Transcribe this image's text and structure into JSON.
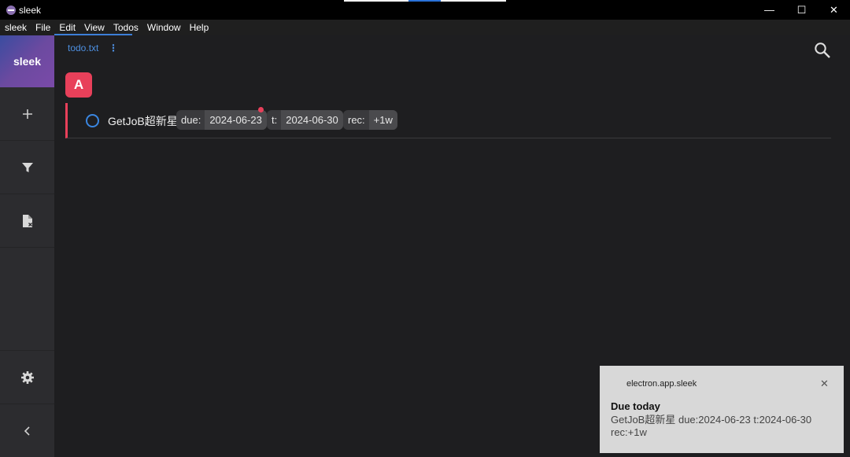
{
  "window": {
    "title": "sleek",
    "minimize": "—",
    "maximize": "☐",
    "close": "✕"
  },
  "menu": [
    "sleek",
    "File",
    "Edit",
    "View",
    "Todos",
    "Window",
    "Help"
  ],
  "sidebar": {
    "brand": "sleek",
    "items": [
      {
        "icon": "plus-icon"
      },
      {
        "icon": "filter-icon"
      },
      {
        "icon": "file-close-icon"
      }
    ],
    "bottom": [
      {
        "icon": "gear-icon"
      },
      {
        "icon": "chevron-left-icon"
      }
    ]
  },
  "main": {
    "file_tab": "todo.txt",
    "file_tab_menu": "⋮",
    "priority_group": "A",
    "todo": {
      "text": "GetJoB超新星",
      "due_key": "due:",
      "due_value": "2024-06-23",
      "t_key": "t:",
      "t_value": "2024-06-30",
      "rec_key": "rec:",
      "rec_value": "+1w"
    }
  },
  "notification": {
    "app": "electron.app.sleek",
    "close": "✕",
    "title": "Due today",
    "body": "GetJoB超新星 due:2024-06-23 t:2024-06-30 rec:+1w"
  },
  "colors": {
    "accent": "#3c7fd8",
    "priority_a": "#e8405a",
    "background": "#1e1e20",
    "sidebar": "#2c2c2f"
  }
}
